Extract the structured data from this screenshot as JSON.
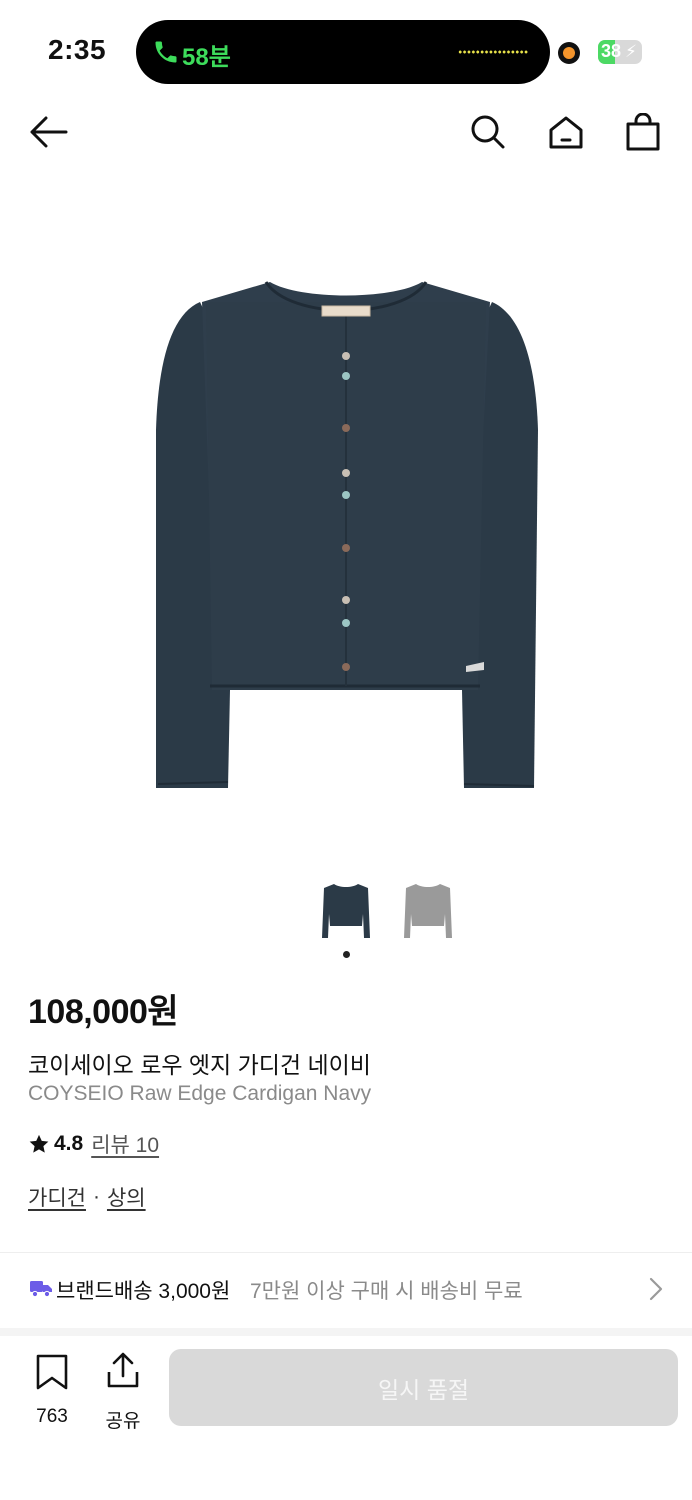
{
  "status_bar": {
    "time": "2:35",
    "call_duration": "58분",
    "battery_level": "38",
    "battery_percent": 38,
    "call_color": "#3ddc5b",
    "battery_color": "#4cd964"
  },
  "nav": {
    "back_icon": "arrow-left-icon",
    "search_icon": "search-icon",
    "home_icon": "home-icon",
    "cart_icon": "shopping-bag-icon"
  },
  "product": {
    "price": "108,000원",
    "name_ko": "코이세이오 로우 엣지 가디건 네이비",
    "name_en": "COYSEIO Raw Edge Cardigan Navy",
    "rating": "4.8",
    "review_label": "리뷰 10",
    "categories": [
      "가디건",
      "상의"
    ],
    "category_separator": "·",
    "brand_tag": "COYSEIO",
    "colors": {
      "navy": "#2b3a47",
      "gray": "#9a9a9a"
    }
  },
  "shipping": {
    "label": "브랜드배송 3,000원",
    "detail": "7만원 이상 구매 시 배송비 무료",
    "truck_color": "#6c5ce7"
  },
  "bottom_bar": {
    "bookmark_count": "763",
    "share_label": "공유",
    "cta_label": "일시 품절"
  }
}
